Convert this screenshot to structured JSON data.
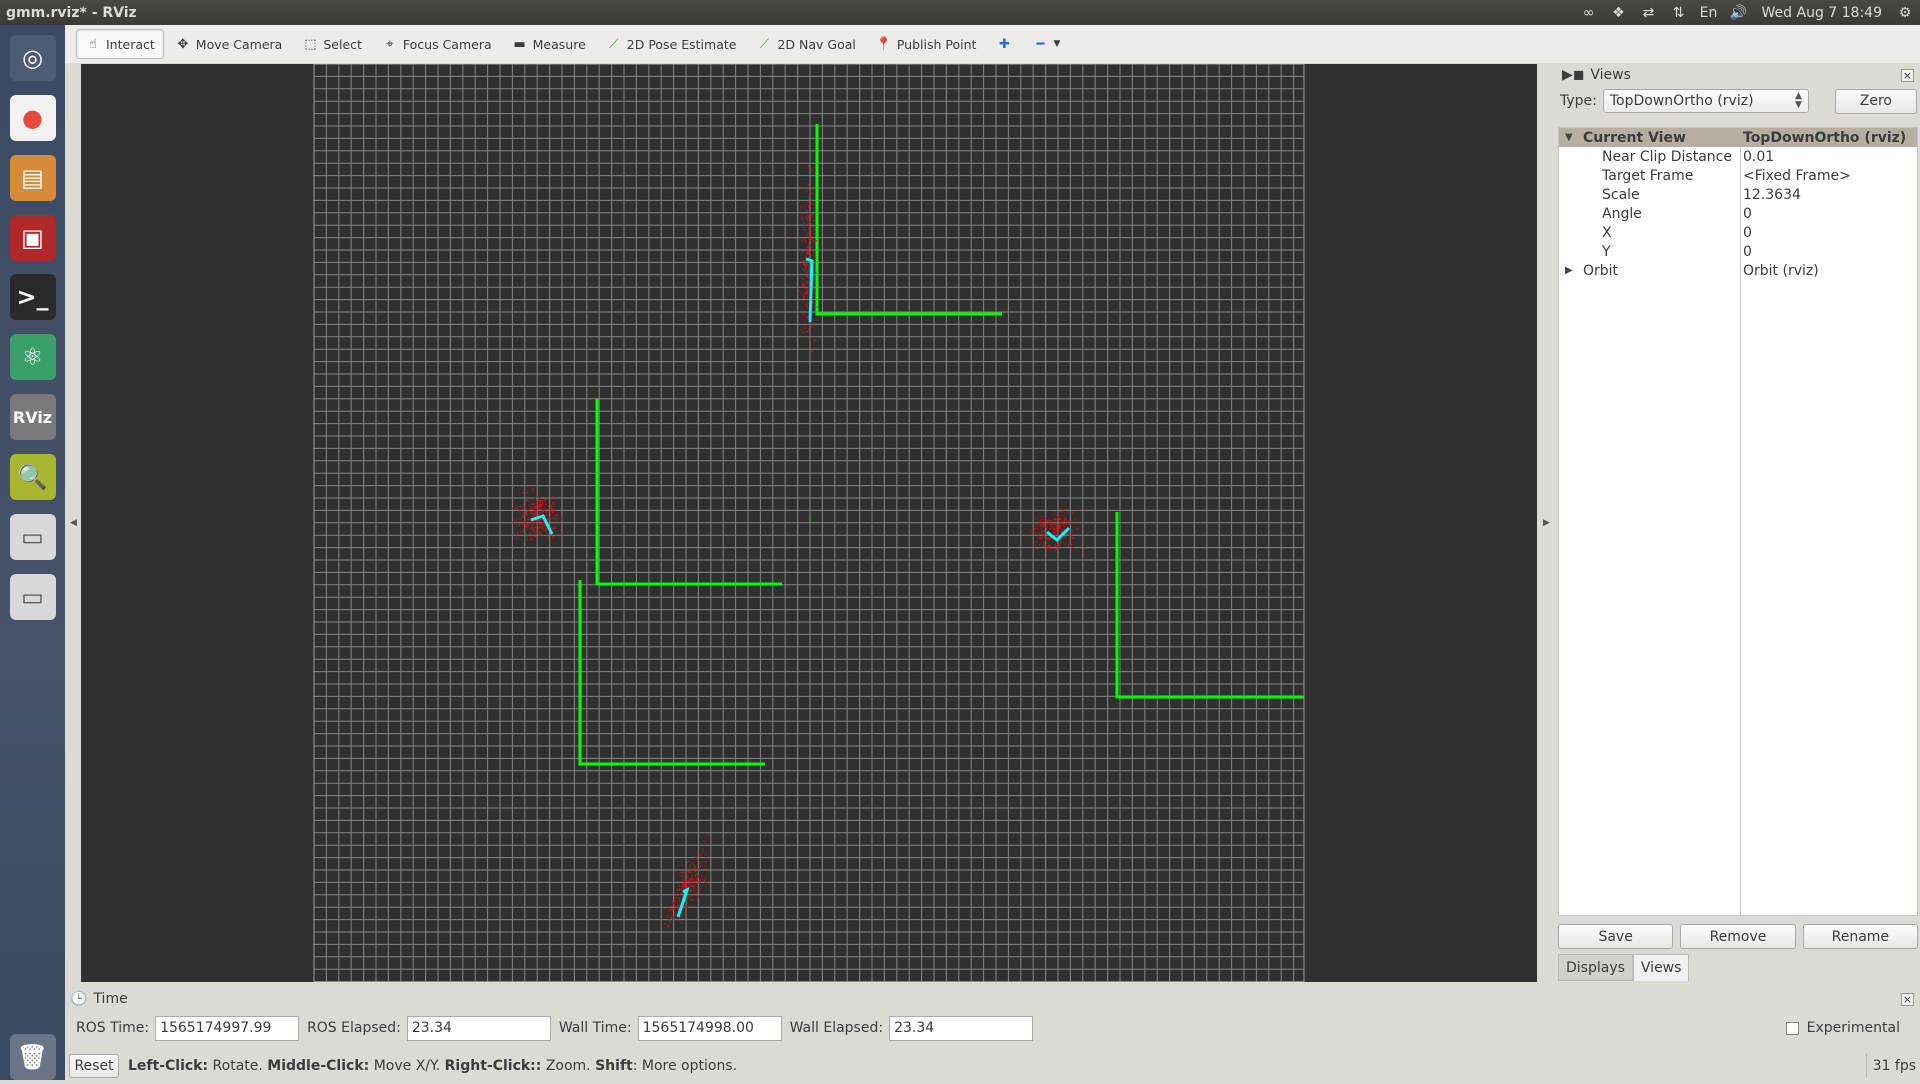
{
  "window": {
    "title": "gmm.rviz* - RViz"
  },
  "tray": {
    "clock": "Wed Aug  7 18:49",
    "keyboard": "En"
  },
  "launcher": {
    "items": [
      {
        "name": "ubuntu-dash-icon",
        "glyph": "◎"
      },
      {
        "name": "chrome-icon",
        "glyph": "●"
      },
      {
        "name": "files-icon",
        "glyph": "▤"
      },
      {
        "name": "remote-desktop-icon",
        "glyph": "▣"
      },
      {
        "name": "terminal-icon",
        "glyph": ">_"
      },
      {
        "name": "atom-icon",
        "glyph": "⚛"
      },
      {
        "name": "rviz-icon",
        "glyph": "RViz"
      },
      {
        "name": "image-viewer-icon",
        "glyph": "🔍"
      },
      {
        "name": "drive-icon",
        "glyph": "▭"
      },
      {
        "name": "drive-icon-2",
        "glyph": "▭"
      },
      {
        "name": "trash-icon",
        "glyph": "🗑"
      }
    ]
  },
  "toolbar": {
    "tools": [
      {
        "label": "Interact",
        "icon": "hand-icon",
        "glyph": "☝",
        "active": true
      },
      {
        "label": "Move Camera",
        "icon": "move-camera-icon",
        "glyph": "✥",
        "active": false
      },
      {
        "label": "Select",
        "icon": "select-icon",
        "glyph": "⬚",
        "active": false
      },
      {
        "label": "Focus Camera",
        "icon": "focus-camera-icon",
        "glyph": "⌖",
        "active": false
      },
      {
        "label": "Measure",
        "icon": "ruler-icon",
        "glyph": "▬",
        "active": false
      },
      {
        "label": "2D Pose Estimate",
        "icon": "pose-arrow-icon",
        "glyph": "⟋",
        "active": false
      },
      {
        "label": "2D Nav Goal",
        "icon": "nav-goal-icon",
        "glyph": "⟋",
        "active": false
      },
      {
        "label": "Publish Point",
        "icon": "map-pin-icon",
        "glyph": "📍",
        "active": false
      }
    ],
    "add_tool_glyph": "✚",
    "remove_tool_glyph": "━"
  },
  "views_panel": {
    "title": "Views",
    "type_label": "Type:",
    "type_value": "TopDownOrtho (rviz)",
    "zero_label": "Zero",
    "properties": [
      {
        "name": "Current View",
        "value": "TopDownOrtho (rviz)",
        "level": 0,
        "expander": "▼",
        "selected": true
      },
      {
        "name": "Near Clip Distance",
        "value": "0.01",
        "level": 1
      },
      {
        "name": "Target Frame",
        "value": "<Fixed Frame>",
        "level": 1
      },
      {
        "name": "Scale",
        "value": "12.3634",
        "level": 1
      },
      {
        "name": "Angle",
        "value": "0",
        "level": 1
      },
      {
        "name": "X",
        "value": "0",
        "level": 1
      },
      {
        "name": "Y",
        "value": "0",
        "level": 1
      },
      {
        "name": "Orbit",
        "value": "Orbit (rviz)",
        "level": 0,
        "expander": "▶"
      }
    ],
    "buttons": {
      "save": "Save",
      "remove": "Remove",
      "rename": "Rename"
    },
    "tabs": {
      "displays": "Displays",
      "views": "Views"
    }
  },
  "time_panel": {
    "title": "Time",
    "ros_time_label": "ROS Time:",
    "ros_time_value": "1565174997.99",
    "ros_elapsed_label": "ROS Elapsed:",
    "ros_elapsed_value": "23.34",
    "wall_time_label": "Wall Time:",
    "wall_time_value": "1565174998.00",
    "wall_elapsed_label": "Wall Elapsed:",
    "wall_elapsed_value": "23.34",
    "experimental_label": "Experimental"
  },
  "status_bar": {
    "reset_label": "Reset",
    "left_click_key": "Left-Click:",
    "left_click_text": " Rotate. ",
    "middle_click_key": "Middle-Click:",
    "middle_click_text": " Move X/Y. ",
    "right_click_key": "Right-Click::",
    "right_click_text": " Zoom. ",
    "shift_key": "Shift",
    "shift_text": ": More options.",
    "fps": "31 fps"
  },
  "colors": {
    "grid": "#a0a0a0",
    "walls": "#00ff00",
    "robot_pose": "#00ffff",
    "particles": "#ff0000"
  }
}
